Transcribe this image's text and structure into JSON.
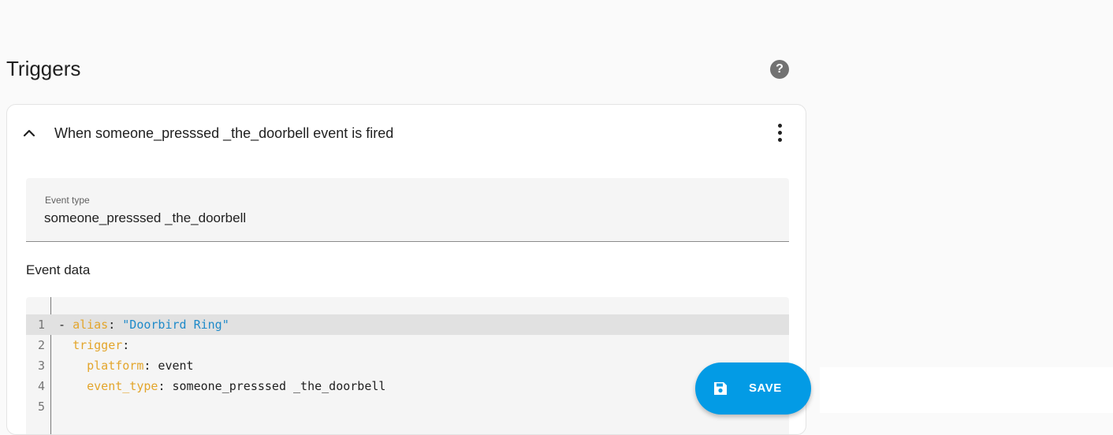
{
  "section": {
    "title": "Triggers",
    "help_icon": "help-circle-icon"
  },
  "trigger_card": {
    "title": "When someone_presssed _the_doorbell event is fired",
    "expand_icon": "chevron-up-icon",
    "menu_icon": "dots-vertical-icon"
  },
  "event_type": {
    "label": "Event type",
    "value": "someone_presssed _the_doorbell"
  },
  "event_data": {
    "label": "Event data",
    "lines": [
      {
        "no": "1",
        "parts": [
          [
            "plain",
            "- "
          ],
          [
            "key",
            "alias"
          ],
          [
            "plain",
            ": "
          ],
          [
            "str",
            "\"Doorbird Ring\""
          ]
        ]
      },
      {
        "no": "2",
        "parts": [
          [
            "plain",
            "  "
          ],
          [
            "key",
            "trigger"
          ],
          [
            "plain",
            ":"
          ]
        ]
      },
      {
        "no": "3",
        "parts": [
          [
            "plain",
            "    "
          ],
          [
            "key",
            "platform"
          ],
          [
            "plain",
            ": event"
          ]
        ]
      },
      {
        "no": "4",
        "parts": [
          [
            "plain",
            "    "
          ],
          [
            "key",
            "event_type"
          ],
          [
            "plain",
            ": someone_presssed _the_doorbell"
          ]
        ]
      },
      {
        "no": "5",
        "parts": []
      }
    ]
  },
  "save_button": {
    "label": "SAVE",
    "icon": "content-save-icon",
    "color": "#039be5"
  },
  "colors": {
    "yaml_key": "#e3a52b",
    "yaml_string": "#1f8ac9"
  }
}
